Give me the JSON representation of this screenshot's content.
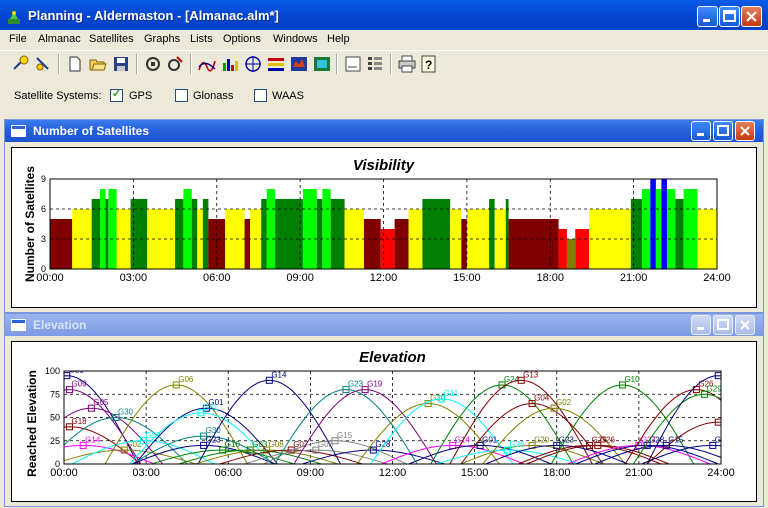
{
  "window": {
    "title": "Planning - Aldermaston - [Almanac.alm*]",
    "accent": "#0450d6"
  },
  "menu": [
    "File",
    "Almanac",
    "Satellites",
    "Graphs",
    "Lists",
    "Options",
    "Windows",
    "Help"
  ],
  "toolbar_icons": [
    "open-satellite-icon",
    "satellite-edit-icon",
    "new-document-icon",
    "open-folder-icon",
    "save-icon",
    "station-icon",
    "station-edit-icon",
    "elevation-graph-icon",
    "bar-graph-icon",
    "sky-plot-icon",
    "dop-icon",
    "world-map-icon",
    "world-view-icon",
    "table-icon",
    "list-icon",
    "print-icon",
    "help-icon"
  ],
  "satellite_systems": {
    "label": "Satellite Systems:",
    "options": [
      {
        "name": "GPS",
        "checked": true
      },
      {
        "name": "Glonass",
        "checked": false
      },
      {
        "name": "WAAS",
        "checked": false
      }
    ]
  },
  "panels": {
    "visibility_window": "Number of Satellites",
    "elevation_window": "Elevation"
  },
  "chart_data": [
    {
      "type": "bar",
      "title": "Visibility",
      "ylabel": "Number of Satellites",
      "xlabel": "",
      "x_ticks": [
        "00:00",
        "03:00",
        "06:00",
        "09:00",
        "12:00",
        "15:00",
        "18:00",
        "21:00",
        "24:00"
      ],
      "y_ticks": [
        "0",
        "3",
        "6",
        "9"
      ],
      "ylim": [
        0,
        9
      ],
      "xlim_hours": [
        0,
        24
      ],
      "grid": "dashed",
      "colors": {
        "3": "#808000",
        "4": "#ff0000",
        "5": "#800000",
        "6": "#ffff00",
        "7": "#008000",
        "8": "#00ff00",
        "9": "#0000ff"
      },
      "segments": [
        [
          0.0,
          0.8,
          5
        ],
        [
          0.8,
          1.5,
          6
        ],
        [
          1.5,
          1.8,
          7
        ],
        [
          1.8,
          2.0,
          8
        ],
        [
          2.0,
          2.1,
          7
        ],
        [
          2.1,
          2.4,
          8
        ],
        [
          2.4,
          2.9,
          6
        ],
        [
          2.9,
          3.5,
          7
        ],
        [
          3.5,
          4.5,
          6
        ],
        [
          4.5,
          4.8,
          7
        ],
        [
          4.8,
          5.1,
          8
        ],
        [
          5.1,
          5.3,
          7
        ],
        [
          5.3,
          5.5,
          6
        ],
        [
          5.5,
          5.7,
          7
        ],
        [
          5.7,
          6.3,
          5
        ],
        [
          6.3,
          7.0,
          6
        ],
        [
          7.0,
          7.2,
          5
        ],
        [
          7.2,
          7.6,
          6
        ],
        [
          7.6,
          7.8,
          7
        ],
        [
          7.8,
          8.1,
          8
        ],
        [
          8.1,
          9.1,
          7
        ],
        [
          9.1,
          9.6,
          8
        ],
        [
          9.6,
          9.8,
          7
        ],
        [
          9.8,
          10.1,
          8
        ],
        [
          10.1,
          10.6,
          7
        ],
        [
          10.6,
          11.3,
          6
        ],
        [
          11.3,
          11.9,
          5
        ],
        [
          11.9,
          12.4,
          4
        ],
        [
          12.4,
          12.9,
          5
        ],
        [
          12.9,
          13.4,
          6
        ],
        [
          13.4,
          14.4,
          7
        ],
        [
          14.4,
          14.8,
          6
        ],
        [
          14.8,
          15.0,
          5
        ],
        [
          15.0,
          15.8,
          6
        ],
        [
          15.8,
          16.0,
          7
        ],
        [
          16.0,
          16.4,
          6
        ],
        [
          16.4,
          16.5,
          7
        ],
        [
          16.5,
          18.3,
          5
        ],
        [
          18.3,
          18.6,
          4
        ],
        [
          18.6,
          18.9,
          3
        ],
        [
          18.9,
          19.4,
          4
        ],
        [
          19.4,
          20.9,
          6
        ],
        [
          20.9,
          21.3,
          7
        ],
        [
          21.3,
          21.6,
          8
        ],
        [
          21.6,
          21.8,
          9
        ],
        [
          21.8,
          22.0,
          8
        ],
        [
          22.0,
          22.2,
          9
        ],
        [
          22.2,
          22.5,
          8
        ],
        [
          22.5,
          22.8,
          7
        ],
        [
          22.8,
          23.3,
          8
        ],
        [
          23.3,
          24.0,
          6
        ]
      ]
    },
    {
      "type": "line",
      "title": "Elevation",
      "ylabel": "Reached Elevation",
      "xlabel": "",
      "x_ticks": [
        "00:00",
        "03:00",
        "06:00",
        "09:00",
        "12:00",
        "15:00",
        "18:00",
        "21:00",
        "24:00"
      ],
      "y_ticks": [
        "0",
        "25",
        "50",
        "75",
        "100"
      ],
      "ylim": [
        0,
        100
      ],
      "xlim_hours": [
        0,
        24
      ],
      "grid": "dashed",
      "series": [
        {
          "name": "G21",
          "color": "#000080",
          "peak_hour": 0.1,
          "peak_elev": 95
        },
        {
          "name": "G09",
          "color": "#800080",
          "peak_hour": 0.2,
          "peak_elev": 80
        },
        {
          "name": "G18",
          "color": "#800000",
          "peak_hour": 0.2,
          "peak_elev": 40
        },
        {
          "name": "G05",
          "color": "#800080",
          "peak_hour": 1.0,
          "peak_elev": 60
        },
        {
          "name": "G14",
          "color": "#ff00ff",
          "peak_hour": 0.7,
          "peak_elev": 20
        },
        {
          "name": "G30",
          "color": "#008080",
          "peak_hour": 1.9,
          "peak_elev": 50
        },
        {
          "name": "G02",
          "color": "#808000",
          "peak_hour": 2.2,
          "peak_elev": 15
        },
        {
          "name": "G22",
          "color": "#00ffff",
          "peak_hour": 2.9,
          "peak_elev": 25
        },
        {
          "name": "G06",
          "color": "#808000",
          "peak_hour": 4.1,
          "peak_elev": 85
        },
        {
          "name": "G01",
          "color": "#000080",
          "peak_hour": 5.2,
          "peak_elev": 60
        },
        {
          "name": "G31",
          "color": "#00ffff",
          "peak_hour": 5.0,
          "peak_elev": 55
        },
        {
          "name": "G30",
          "color": "#008080",
          "peak_hour": 5.1,
          "peak_elev": 30
        },
        {
          "name": "G23",
          "color": "#000080",
          "peak_hour": 5.1,
          "peak_elev": 20
        },
        {
          "name": "G10",
          "color": "#008000",
          "peak_hour": 5.8,
          "peak_elev": 15
        },
        {
          "name": "G03",
          "color": "#008000",
          "peak_hour": 6.8,
          "peak_elev": 15
        },
        {
          "name": "G14",
          "color": "#000080",
          "peak_hour": 7.5,
          "peak_elev": 90
        },
        {
          "name": "G08",
          "color": "#808000",
          "peak_hour": 7.4,
          "peak_elev": 15
        },
        {
          "name": "G07",
          "color": "#800000",
          "peak_hour": 8.3,
          "peak_elev": 15
        },
        {
          "name": "G08",
          "color": "#808080",
          "peak_hour": 9.2,
          "peak_elev": 15
        },
        {
          "name": "G15",
          "color": "#808080",
          "peak_hour": 9.9,
          "peak_elev": 25
        },
        {
          "name": "G19",
          "color": "#800080",
          "peak_hour": 11.0,
          "peak_elev": 80
        },
        {
          "name": "G23",
          "color": "#008080",
          "peak_hour": 10.3,
          "peak_elev": 80
        },
        {
          "name": "G28",
          "color": "#000080",
          "peak_hour": 11.3,
          "peak_elev": 15
        },
        {
          "name": "G20",
          "color": "#808000",
          "peak_hour": 13.3,
          "peak_elev": 65
        },
        {
          "name": "G11",
          "color": "#00ffff",
          "peak_hour": 13.8,
          "peak_elev": 70
        },
        {
          "name": "G14",
          "color": "#ff00ff",
          "peak_hour": 14.2,
          "peak_elev": 20
        },
        {
          "name": "G01",
          "color": "#000080",
          "peak_hour": 15.2,
          "peak_elev": 20
        },
        {
          "name": "G24",
          "color": "#008000",
          "peak_hour": 16.0,
          "peak_elev": 85
        },
        {
          "name": "G13",
          "color": "#800000",
          "peak_hour": 16.7,
          "peak_elev": 90
        },
        {
          "name": "G04",
          "color": "#800000",
          "peak_hour": 17.1,
          "peak_elev": 65
        },
        {
          "name": "G20",
          "color": "#808000",
          "peak_hour": 17.1,
          "peak_elev": 20
        },
        {
          "name": "G26",
          "color": "#00ffff",
          "peak_hour": 16.2,
          "peak_elev": 15
        },
        {
          "name": "G02",
          "color": "#808000",
          "peak_hour": 17.9,
          "peak_elev": 60
        },
        {
          "name": "G23",
          "color": "#000080",
          "peak_hour": 18.0,
          "peak_elev": 20
        },
        {
          "name": "G29",
          "color": "#800000",
          "peak_hour": 19.2,
          "peak_elev": 20
        },
        {
          "name": "G26",
          "color": "#800000",
          "peak_hour": 19.5,
          "peak_elev": 20
        },
        {
          "name": "G10",
          "color": "#008000",
          "peak_hour": 20.4,
          "peak_elev": 85
        },
        {
          "name": "G27",
          "color": "#ff00ff",
          "peak_hour": 21.0,
          "peak_elev": 20
        },
        {
          "name": "G28",
          "color": "#000080",
          "peak_hour": 21.3,
          "peak_elev": 20
        },
        {
          "name": "G15",
          "color": "#000080",
          "peak_hour": 22.0,
          "peak_elev": 20
        },
        {
          "name": "G26",
          "color": "#800000",
          "peak_hour": 23.1,
          "peak_elev": 80
        },
        {
          "name": "G29",
          "color": "#008000",
          "peak_hour": 23.4,
          "peak_elev": 75
        },
        {
          "name": "G01",
          "color": "#000080",
          "peak_hour": 23.9,
          "peak_elev": 95
        },
        {
          "name": "G18",
          "color": "#800000",
          "peak_hour": 23.9,
          "peak_elev": 45
        },
        {
          "name": "G28",
          "color": "#000080",
          "peak_hour": 23.7,
          "peak_elev": 20
        }
      ]
    }
  ]
}
